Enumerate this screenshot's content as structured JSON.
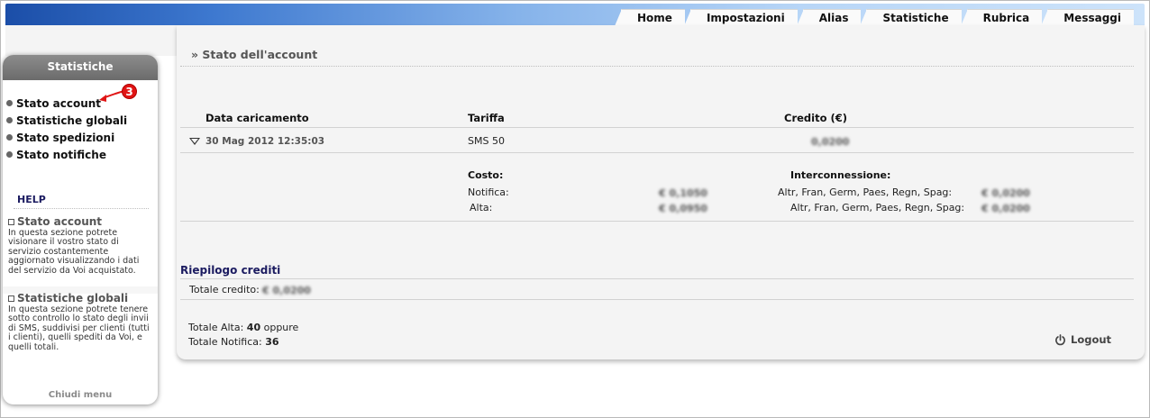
{
  "tabs": [
    "Home",
    "Impostazioni",
    "Alias",
    "Statistiche",
    "Rubrica",
    "Messaggi"
  ],
  "sidebar": {
    "title": "Statistiche",
    "items": [
      "Stato account",
      "Statistiche globali",
      "Stato spedizioni",
      "Stato notifiche"
    ],
    "help_title": "HELP",
    "help": [
      {
        "title": "Stato account",
        "text": "In questa sezione potrete visionare il vostro stato di servizio costantemente aggiornato visualizzando i dati del servizio da Voi acquistato."
      },
      {
        "title": "Statistiche globali",
        "text": "In questa sezione potrete tenere sotto controllo lo stato degli invii di SMS, suddivisi per clienti (tutti i clienti), quelli spediti da Voi, e quelli totali."
      }
    ],
    "close_label": "Chiudi menu"
  },
  "annotation": {
    "badge": "3",
    "color": "#e01515"
  },
  "main": {
    "page_title": "» Stato dell'account",
    "headers": {
      "date": "Data caricamento",
      "tariff": "Tariffa",
      "credit": "Credito (€)"
    },
    "row": {
      "date": "30 Mag 2012 12:35:03",
      "tariff": "SMS 50",
      "credit": "0,0200"
    },
    "costs": {
      "title": "Costo:",
      "notifica_label": "Notifica:",
      "notifica_value": "€ 0,1050",
      "alta_label": "Alta:",
      "alta_value": "€ 0,0950"
    },
    "interconnect": {
      "title": "Interconnessione:",
      "line1_label": "Altr, Fran, Germ, Paes, Regn, Spag:",
      "line1_value": "€ 0,0200",
      "line2_label": "Altr, Fran, Germ, Paes, Regn, Spag:",
      "line2_value": "€ 0,0200"
    },
    "summary": {
      "title": "Riepilogo crediti",
      "total_credit_label": "Totale credito:",
      "total_credit_value": "€ 0,0200",
      "alta_label": "Totale Alta:",
      "alta_value": "40",
      "alta_suffix": "oppure",
      "notifica_label": "Totale Notifica:",
      "notifica_value": "36"
    },
    "logout_label": "Logout"
  }
}
